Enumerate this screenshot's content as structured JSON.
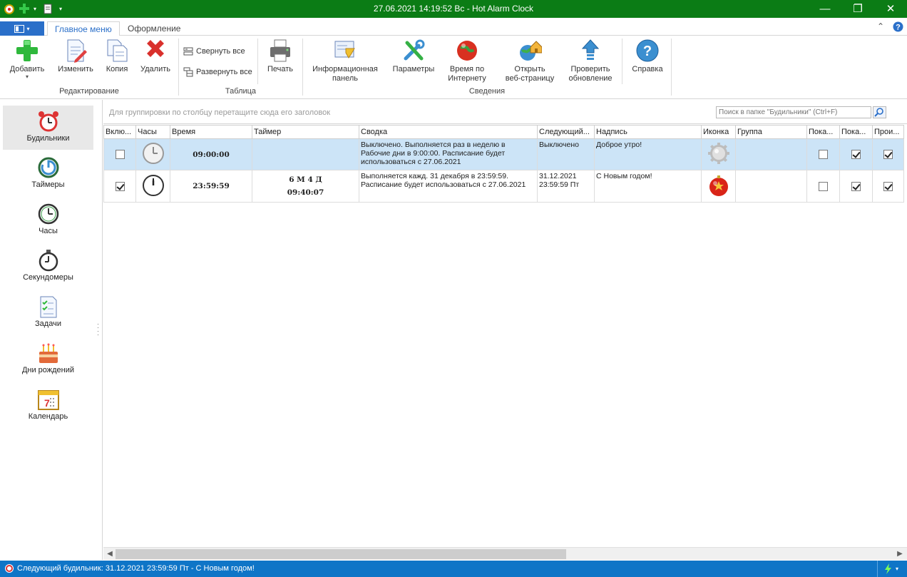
{
  "window": {
    "title": "27.06.2021 14:19:52 Вс - Hot Alarm Clock",
    "colors": {
      "titlebar": "#0b7c15",
      "statusbar": "#0f75c7",
      "accent": "#2a6fc9",
      "selected_row": "#cce4f7"
    }
  },
  "tabs": [
    {
      "label": "Главное меню",
      "active": true
    },
    {
      "label": "Оформление",
      "active": false
    }
  ],
  "ribbon": {
    "add": "Добавить",
    "edit": "Изменить",
    "copy": "Копия",
    "delete": "Удалить",
    "group_edit": "Редактирование",
    "collapse_all": "Свернуть все",
    "expand_all": "Развернуть все",
    "print": "Печать",
    "group_table": "Таблица",
    "info_panel_1": "Информационная",
    "info_panel_2": "панель",
    "params": "Параметры",
    "inet_time_1": "Время по",
    "inet_time_2": "Интернету",
    "open_web_1": "Открыть",
    "open_web_2": "веб-страницу",
    "check_update_1": "Проверить",
    "check_update_2": "обновление",
    "help": "Справка",
    "group_info": "Сведения"
  },
  "nav": [
    {
      "label": "Будильники",
      "icon": "alarm-clock-icon",
      "active": true
    },
    {
      "label": "Таймеры",
      "icon": "timer-icon"
    },
    {
      "label": "Часы",
      "icon": "clock-icon"
    },
    {
      "label": "Секундомеры",
      "icon": "stopwatch-icon"
    },
    {
      "label": "Задачи",
      "icon": "tasks-icon"
    },
    {
      "label": "Дни рождений",
      "icon": "birthday-cake-icon"
    },
    {
      "label": "Календарь",
      "icon": "calendar-icon"
    }
  ],
  "grid": {
    "group_hint": "Для группировки по столбцу перетащите сюда его заголовок",
    "search_placeholder": "Поиск в папке \"Будильники\" (Ctrl+F)",
    "columns": [
      "Вклю...",
      "Часы",
      "Время",
      "Таймер",
      "Сводка",
      "Следующий...",
      "Надпись",
      "Иконка",
      "Группа",
      "Пока...",
      "Пока...",
      "Прои..."
    ],
    "rows": [
      {
        "enabled": false,
        "time": "09:00:00",
        "timer_1": "",
        "timer_2": "",
        "summary_1": "Выключено. Выполняется раз в неделю в",
        "summary_2": "Рабочие дни в 9:00:00. Расписание будет",
        "summary_3": "использоваться с 27.06.2021",
        "next_1": "Выключено",
        "next_2": "",
        "caption": "Доброе утро!",
        "icon": "gear-badge-icon",
        "group": "",
        "show1": false,
        "show2": true,
        "play": true
      },
      {
        "enabled": true,
        "time": "23:59:59",
        "timer_1": "6 М  4 Д",
        "timer_2": "09:40:07",
        "summary_1": "Выполняется кажд. 31 декабря в 23:59:59.",
        "summary_2": "Расписание будет использоваться с 27.06.2021",
        "summary_3": "",
        "next_1": "31.12.2021",
        "next_2": "23:59:59 Пт",
        "caption": "С Новым годом!",
        "icon": "christmas-ball-icon",
        "group": "",
        "show1": false,
        "show2": true,
        "play": true
      }
    ]
  },
  "status": {
    "text": "Следующий будильник: 31.12.2021 23:59:59 Пт - С Новым годом!"
  }
}
